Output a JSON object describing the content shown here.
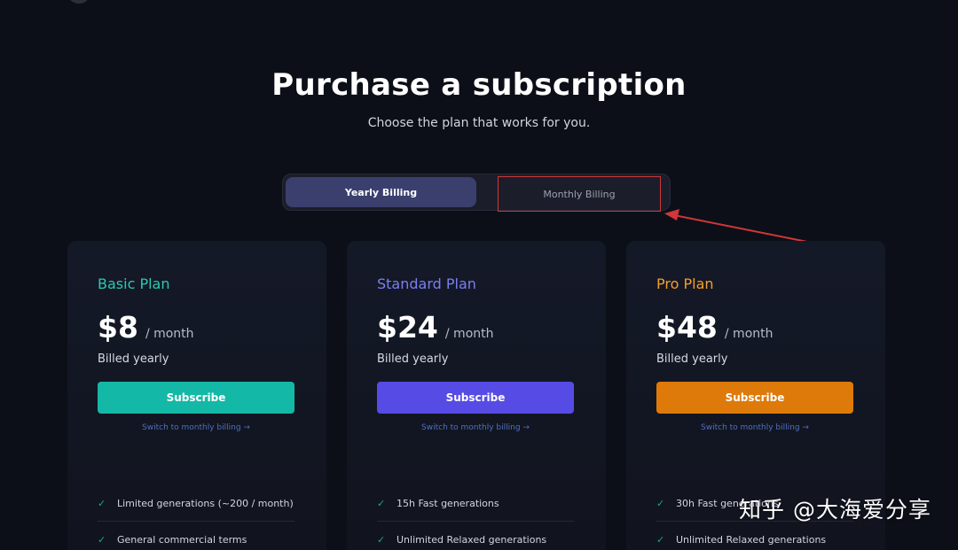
{
  "header": {
    "title": "Purchase a subscription",
    "subtitle": "Choose the plan that works for you."
  },
  "billing_toggle": {
    "yearly_label": "Yearly Billing",
    "monthly_label": "Monthly Billing",
    "selected": "Yearly Billing"
  },
  "annotation": {
    "highlight_color": "#d0363a"
  },
  "plans": [
    {
      "name": "Basic Plan",
      "name_color": "#2dc8b0",
      "price": "$8",
      "period": "/ month",
      "billed": "Billed yearly",
      "button_label": "Subscribe",
      "button_color": "#14b8a6",
      "switch_label": "Switch to monthly billing →",
      "features": [
        "Limited generations (~200 / month)",
        "General commercial terms"
      ]
    },
    {
      "name": "Standard Plan",
      "name_color": "#7b7ff0",
      "price": "$24",
      "period": "/ month",
      "billed": "Billed yearly",
      "button_label": "Subscribe",
      "button_color": "#574be5",
      "switch_label": "Switch to monthly billing →",
      "features": [
        "15h Fast generations",
        "Unlimited Relaxed generations"
      ]
    },
    {
      "name": "Pro Plan",
      "name_color": "#f59e2b",
      "price": "$48",
      "period": "/ month",
      "billed": "Billed yearly",
      "button_label": "Subscribe",
      "button_color": "#de7a0a",
      "switch_label": "Switch to monthly billing →",
      "features": [
        "30h Fast generations",
        "Unlimited Relaxed generations"
      ]
    }
  ],
  "watermark": "知乎 @大海爱分享"
}
